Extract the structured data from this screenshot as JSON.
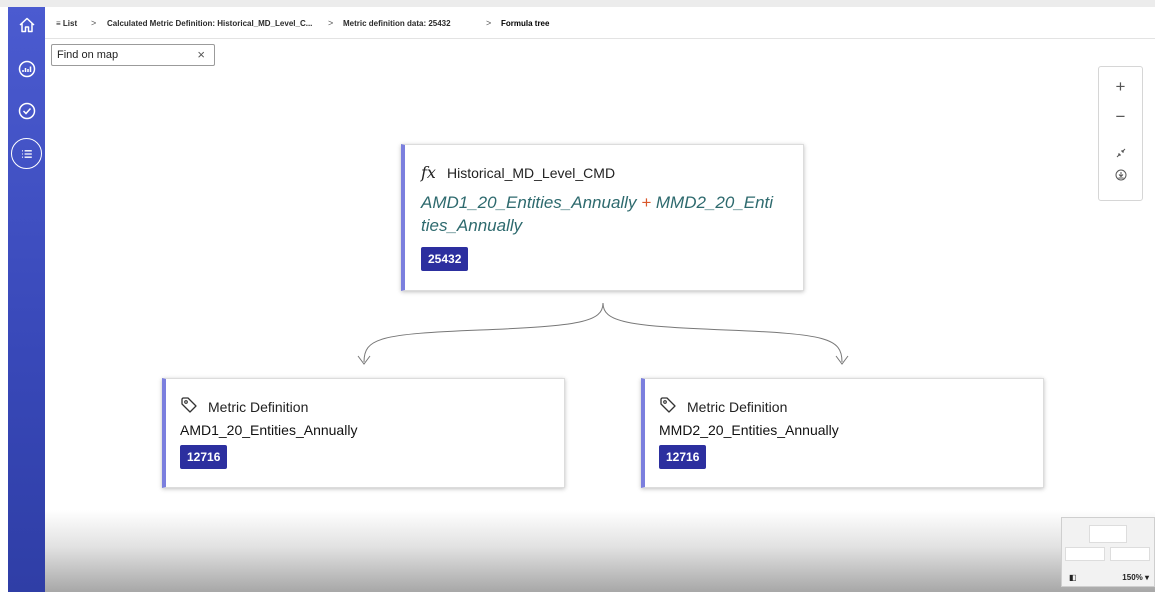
{
  "breadcrumb": {
    "list_icon": "≡",
    "list_label": "List",
    "sep": ">",
    "items": [
      "Calculated Metric Definition: Historical_MD_Level_C...",
      "Metric definition data: 25432",
      "Formula tree"
    ]
  },
  "find": {
    "value": "Find on map",
    "clear_icon": "×"
  },
  "zoom_controls": {
    "zoom_in": "+",
    "zoom_out": "−",
    "fit": "fit-icon",
    "download": "download-icon"
  },
  "sidebar": {
    "icons": [
      "home-icon",
      "gauge-icon",
      "check-circle-icon",
      "list-icon"
    ]
  },
  "root_node": {
    "fx_symbol": "fx",
    "name": "Historical_MD_Level_CMD",
    "formula_left": "AMD1_20_Entities_Annually",
    "operator": "+",
    "formula_right": "MMD2_20_Enti ties_Annually",
    "badge": "25432"
  },
  "child_nodes": [
    {
      "title": "Metric Definition",
      "name": "AMD1_20_Entities_Annually",
      "badge": "12716",
      "icon": "tag-icon"
    },
    {
      "title": "Metric Definition",
      "name": "MMD2_20_Entities_Annually",
      "badge": "12716",
      "icon": "tag-icon"
    }
  ],
  "minimap": {
    "zoom": "150% ▾"
  },
  "colors": {
    "sidebar": "#3848b8",
    "accent": "#7b7fde",
    "badge": "#2c2f9f",
    "formula": "#2e6a6e",
    "operator": "#d9572a"
  }
}
